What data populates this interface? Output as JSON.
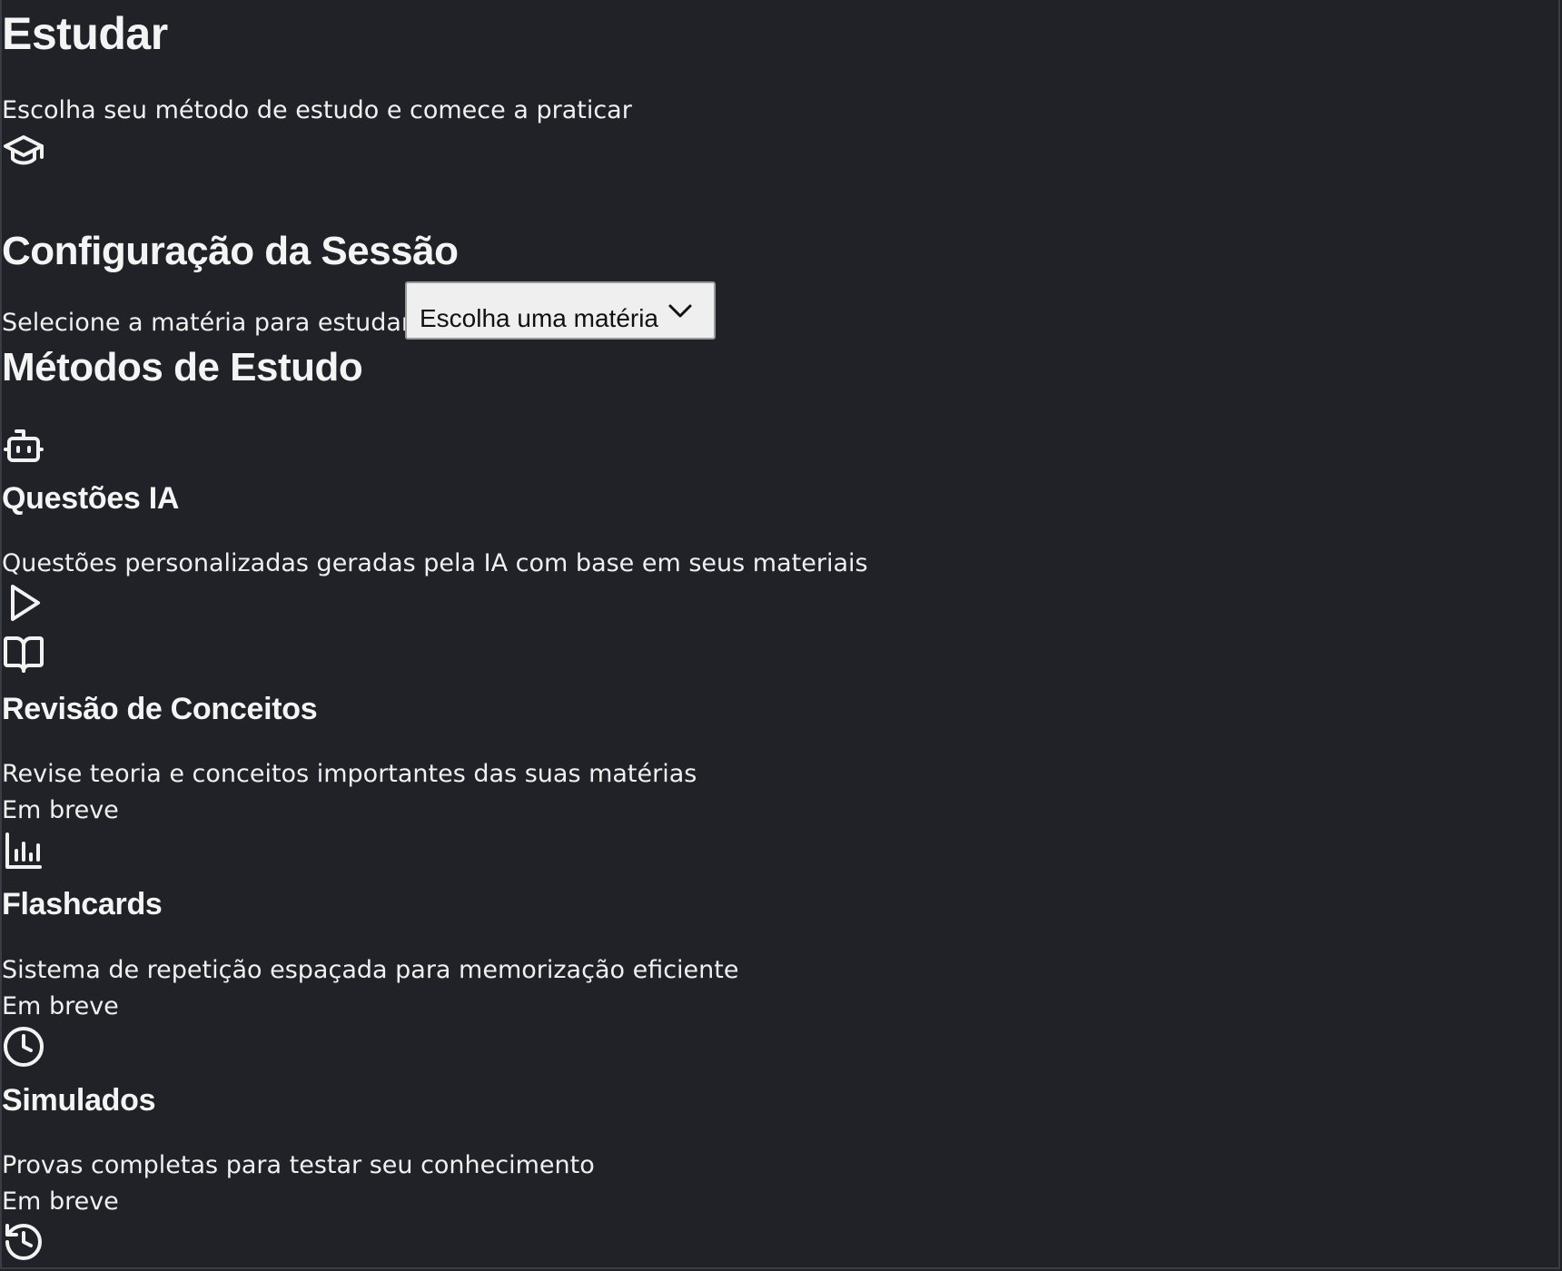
{
  "page": {
    "title": "Estudar",
    "subtitle": "Escolha seu método de estudo e comece a praticar",
    "header_icon": "graduation-cap-icon"
  },
  "session": {
    "heading": "Configuração da Sessão",
    "subject_label": "Selecione a matéria para estudar:",
    "subject_select_value": "Escolha uma matéria"
  },
  "methods": {
    "heading": "Métodos de Estudo",
    "items": [
      {
        "icon": "bot-icon",
        "title": "Questões IA",
        "description": "Questões personalizadas geradas pela IA com base em seus materiais",
        "action_icon": "play-icon"
      },
      {
        "icon": "book-open-icon",
        "title": "Revisão de Conceitos",
        "description": "Revise teoria e conceitos importantes das suas matérias",
        "status": "Em breve"
      },
      {
        "icon": "bar-chart-icon",
        "title": "Flashcards",
        "description": "Sistema de repetição espaçada para memorização eficiente",
        "status": "Em breve"
      },
      {
        "icon": "clock-icon",
        "title": "Simulados",
        "description": "Provas completas para testar seu conhecimento",
        "status": "Em breve"
      }
    ],
    "trailing_icon": "history-icon"
  },
  "colors": {
    "background": "#202227",
    "text": "#f2f2f2",
    "select_bg": "#efefef"
  }
}
